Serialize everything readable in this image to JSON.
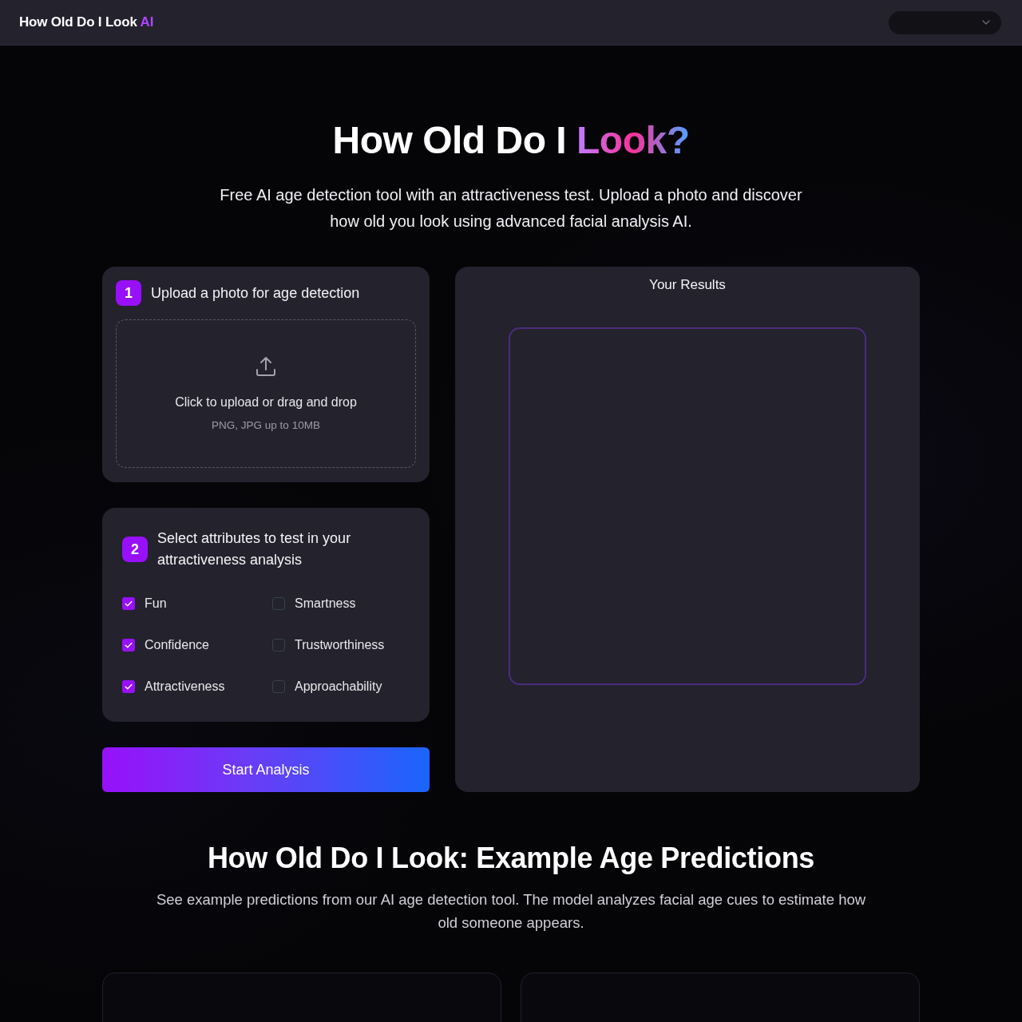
{
  "header": {
    "brand": "How Old Do I Look",
    "brand_highlight": "AI"
  },
  "hero": {
    "title": "How Old Do I",
    "title_highlight": "Look?",
    "subtitle": "Free AI age detection tool with an attractiveness test. Upload a photo and discover how old you look using advanced facial analysis AI."
  },
  "steps": [
    {
      "number": "1",
      "title": "Upload a photo for age detection",
      "dropzone": {
        "prompt": "Click to upload or drag and drop",
        "hint": "PNG, JPG up to 10MB"
      }
    },
    {
      "number": "2",
      "title": "Select attributes to test in your attractiveness analysis",
      "attributes": [
        {
          "label": "Fun",
          "checked": true
        },
        {
          "label": "Smartness",
          "checked": false
        },
        {
          "label": "Confidence",
          "checked": true
        },
        {
          "label": "Trustworthiness",
          "checked": false
        },
        {
          "label": "Attractiveness",
          "checked": true
        },
        {
          "label": "Approachability",
          "checked": false
        }
      ]
    }
  ],
  "start_button": "Start Analysis",
  "results": {
    "title": "Your Results"
  },
  "examples": {
    "title": "How Old Do I Look: Example Age Predictions",
    "description": "See example predictions from our AI age detection tool. The model analyzes facial age cues to estimate how old someone appears."
  }
}
